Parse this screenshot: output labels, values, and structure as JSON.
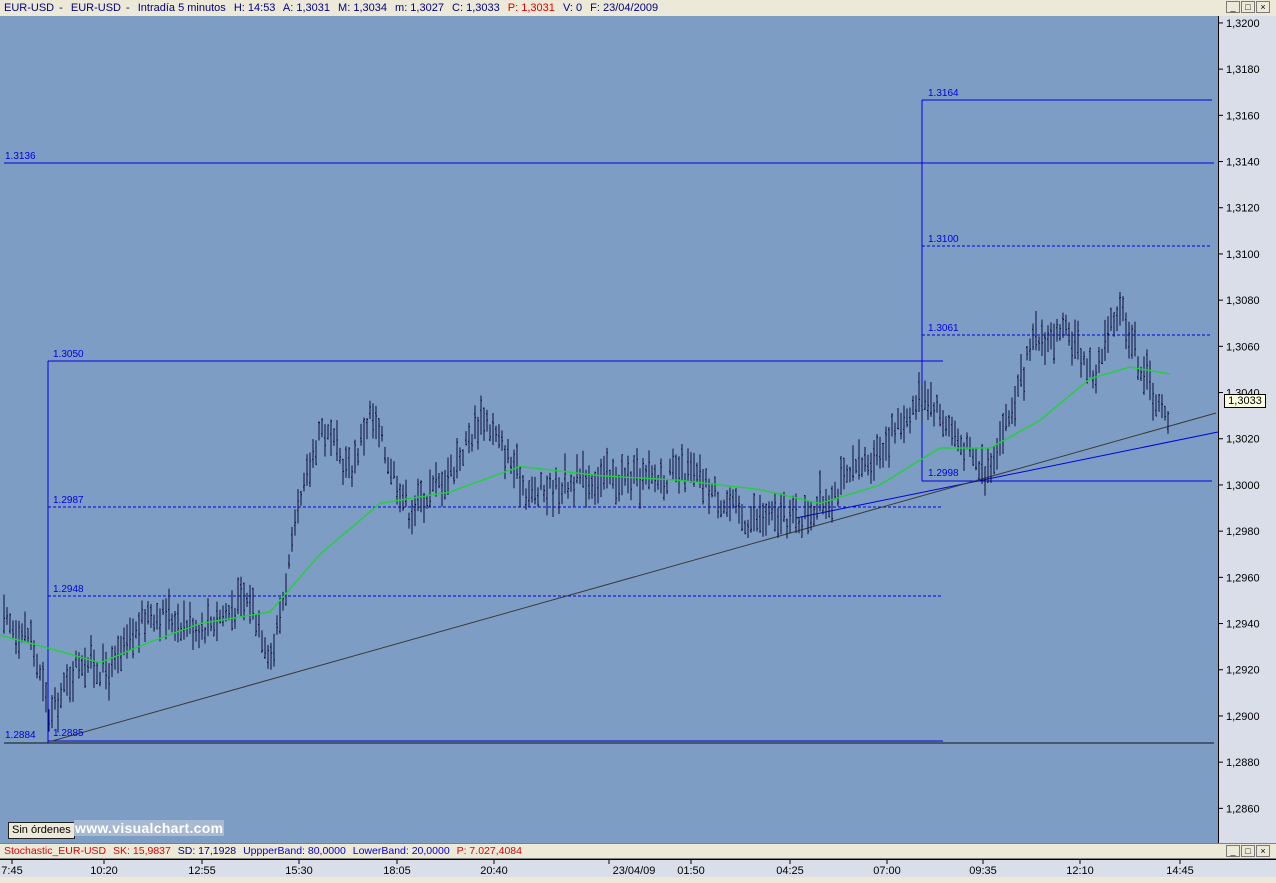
{
  "title_bar": {
    "symbol": "EUR-USD",
    "name": "EUR-USD",
    "interval": "Intradía 5 minutos",
    "H": "H: 14:53",
    "A": "A: 1,3031",
    "M": "M: 1,3034",
    "m": "m: 1,3027",
    "C": "C: 1,3033",
    "P": "P: 1,3031",
    "V": "V: 0",
    "F": "F: 23/04/2009"
  },
  "window_buttons": [
    "_",
    "□",
    "×"
  ],
  "price_axis": {
    "ticks": [
      "1,3200",
      "1,3180",
      "1,3160",
      "1,3140",
      "1,3120",
      "1,3100",
      "1,3080",
      "1,3060",
      "1,3040",
      "1,3020",
      "1,3000",
      "1,2980",
      "1,2960",
      "1,2940",
      "1,2920",
      "1,2900",
      "1,2880",
      "1,2860"
    ],
    "last_price": "1,3033"
  },
  "time_axis": {
    "labels": [
      "7:45",
      "10:20",
      "12:55",
      "15:30",
      "18:05",
      "20:40",
      "23/04/09",
      "01:50",
      "04:25",
      "07:00",
      "09:35",
      "12:10",
      "14:45"
    ]
  },
  "levels": {
    "left_high": "1.3050",
    "left_mid": "1.2987",
    "left_low_mid": "1.2948",
    "left_low": "1.2885",
    "far_low": "1.2884",
    "far_high": "1.3136",
    "right_high": "1.3164",
    "right_mid_high": "1.3100",
    "right_mid": "1.3061",
    "right_low": "1.2998"
  },
  "indicator_bar": {
    "name": "Stochastic_EUR-USD",
    "sk": "SK: 15,9837",
    "sd": "SD: 17,1928",
    "upper": "UppperBand: 80,0000",
    "lower": "LowerBand: 20,0000",
    "p": "P: 7.027,4084"
  },
  "orders_button": "Sin órdenes",
  "watermark": "www.visualchart.com",
  "colors": {
    "chart_bg": "#7E9DC4",
    "bars": "#0A0F3A",
    "moving_average": "#22D03A",
    "fib_lines": "#0000E0",
    "trendline": "#3a3a3a"
  },
  "chart_data": {
    "type": "bar",
    "instrument": "EUR-USD",
    "interval": "Intradía 5 minutos",
    "ylim": [
      1.2845,
      1.3203
    ],
    "price_path": [
      {
        "x": 0,
        "y": 1.294
      },
      {
        "x": 30,
        "y": 1.2935
      },
      {
        "x": 50,
        "y": 1.2898
      },
      {
        "x": 80,
        "y": 1.2925
      },
      {
        "x": 110,
        "y": 1.2918
      },
      {
        "x": 150,
        "y": 1.2945
      },
      {
        "x": 200,
        "y": 1.2938
      },
      {
        "x": 250,
        "y": 1.295
      },
      {
        "x": 272,
        "y": 1.2925
      },
      {
        "x": 300,
        "y": 1.299
      },
      {
        "x": 320,
        "y": 1.3025
      },
      {
        "x": 350,
        "y": 1.3005
      },
      {
        "x": 370,
        "y": 1.303
      },
      {
        "x": 410,
        "y": 1.2988
      },
      {
        "x": 450,
        "y": 1.3005
      },
      {
        "x": 483,
        "y": 1.303
      },
      {
        "x": 530,
        "y": 1.2995
      },
      {
        "x": 580,
        "y": 1.3002
      },
      {
        "x": 650,
        "y": 1.3002
      },
      {
        "x": 690,
        "y": 1.3005
      },
      {
        "x": 745,
        "y": 1.2985
      },
      {
        "x": 800,
        "y": 1.2985
      },
      {
        "x": 830,
        "y": 1.2995
      },
      {
        "x": 880,
        "y": 1.3015
      },
      {
        "x": 925,
        "y": 1.304
      },
      {
        "x": 960,
        "y": 1.3018
      },
      {
        "x": 985,
        "y": 1.3005
      },
      {
        "x": 1010,
        "y": 1.303
      },
      {
        "x": 1035,
        "y": 1.3062
      },
      {
        "x": 1070,
        "y": 1.3064
      },
      {
        "x": 1095,
        "y": 1.3046
      },
      {
        "x": 1120,
        "y": 1.3078
      },
      {
        "x": 1140,
        "y": 1.3052
      },
      {
        "x": 1168,
        "y": 1.3025
      }
    ],
    "moving_average": [
      {
        "x": 0,
        "y": 1.2935
      },
      {
        "x": 60,
        "y": 1.2928
      },
      {
        "x": 100,
        "y": 1.2923
      },
      {
        "x": 150,
        "y": 1.2932
      },
      {
        "x": 200,
        "y": 1.294
      },
      {
        "x": 270,
        "y": 1.2945
      },
      {
        "x": 320,
        "y": 1.297
      },
      {
        "x": 380,
        "y": 1.2992
      },
      {
        "x": 450,
        "y": 1.2997
      },
      {
        "x": 520,
        "y": 1.3008
      },
      {
        "x": 600,
        "y": 1.3004
      },
      {
        "x": 680,
        "y": 1.3002
      },
      {
        "x": 760,
        "y": 1.2998
      },
      {
        "x": 820,
        "y": 1.2992
      },
      {
        "x": 880,
        "y": 1.3
      },
      {
        "x": 940,
        "y": 1.3016
      },
      {
        "x": 990,
        "y": 1.3016
      },
      {
        "x": 1040,
        "y": 1.3028
      },
      {
        "x": 1090,
        "y": 1.3046
      },
      {
        "x": 1130,
        "y": 1.3051
      },
      {
        "x": 1170,
        "y": 1.3048
      }
    ]
  }
}
